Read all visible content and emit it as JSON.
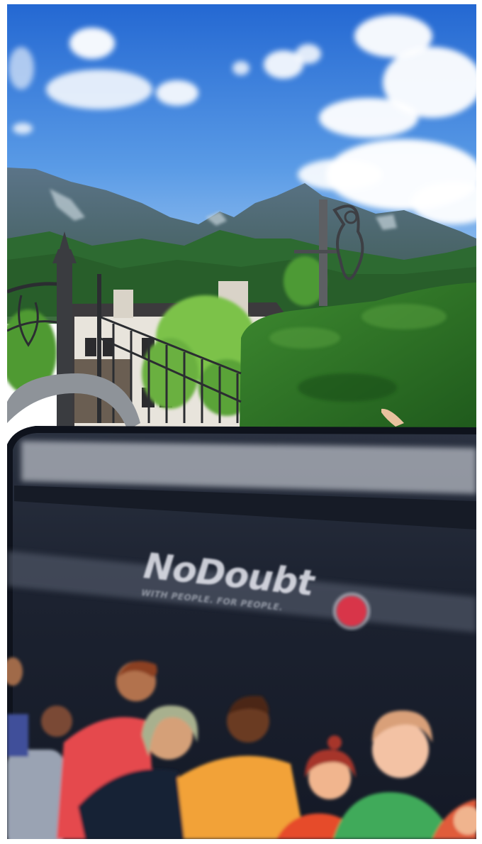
{
  "scene": {
    "colors": {
      "sky_top": "#2b6fd6",
      "sky_bottom": "#8fbef0",
      "mountain": "#4f6f84",
      "forest": "#2f6a2c",
      "hedge": "#2f7a28",
      "screen": "#1a1f2c",
      "accent_dot": "#d8344a"
    }
  },
  "laptop": {
    "brand": "NoDoubt",
    "tagline": "WITH PEOPLE. FOR PEOPLE."
  }
}
